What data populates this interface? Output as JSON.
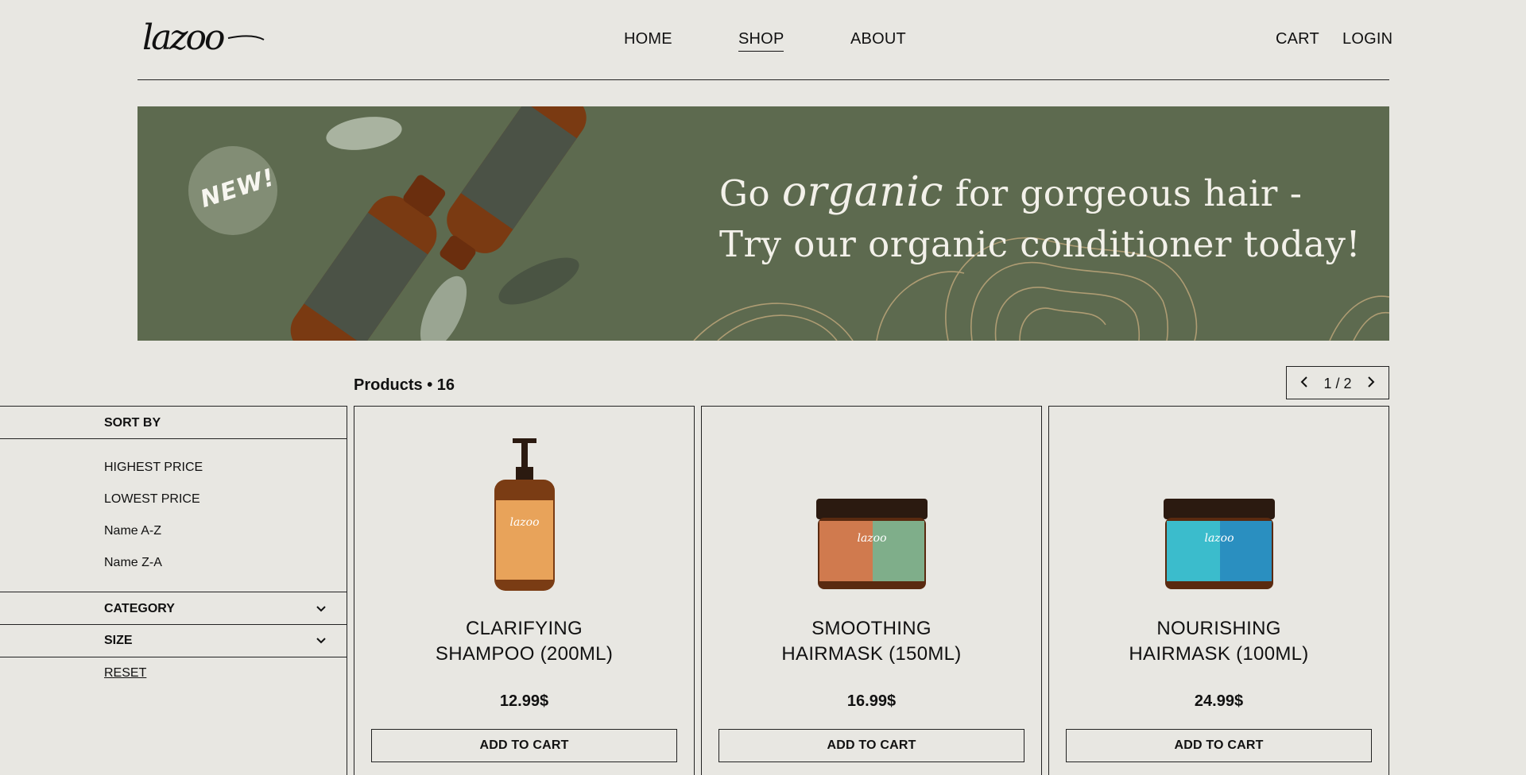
{
  "brand": {
    "logo_text": "lazoo"
  },
  "nav": {
    "home": "HOME",
    "shop": "SHOP",
    "about": "ABOUT",
    "cart": "CART",
    "login": "LOGIN"
  },
  "banner": {
    "badge": "NEW!",
    "line1_pre": "Go ",
    "line1_em": "organic",
    "line1_post": " for gorgeous hair -",
    "line2": "Try our organic conditioner today!",
    "bg_color": "#5d6a4f"
  },
  "toolbar": {
    "products_label": "Products • 16",
    "page_label": "1 / 2"
  },
  "sidebar": {
    "sort_by": "SORT BY",
    "sort_options": [
      "HIGHEST PRICE",
      "LOWEST PRICE",
      "Name A-Z",
      "Name Z-A"
    ],
    "category": "CATEGORY",
    "size": "SIZE",
    "reset": "RESET"
  },
  "products": [
    {
      "name_line1": "CLARIFYING",
      "name_line2": "SHAMPOO (200ML)",
      "price": "12.99$",
      "cta": "ADD TO CART",
      "label_color": "#e8a35a"
    },
    {
      "name_line1": "SMOOTHING",
      "name_line2": "HAIRMASK (150ML)",
      "price": "16.99$",
      "cta": "ADD TO CART",
      "label_color": "#d07a4e"
    },
    {
      "name_line1": "NOURISHING",
      "name_line2": "HAIRMASK (100ML)",
      "price": "24.99$",
      "cta": "ADD TO CART",
      "label_color": "#3bbccc"
    }
  ]
}
